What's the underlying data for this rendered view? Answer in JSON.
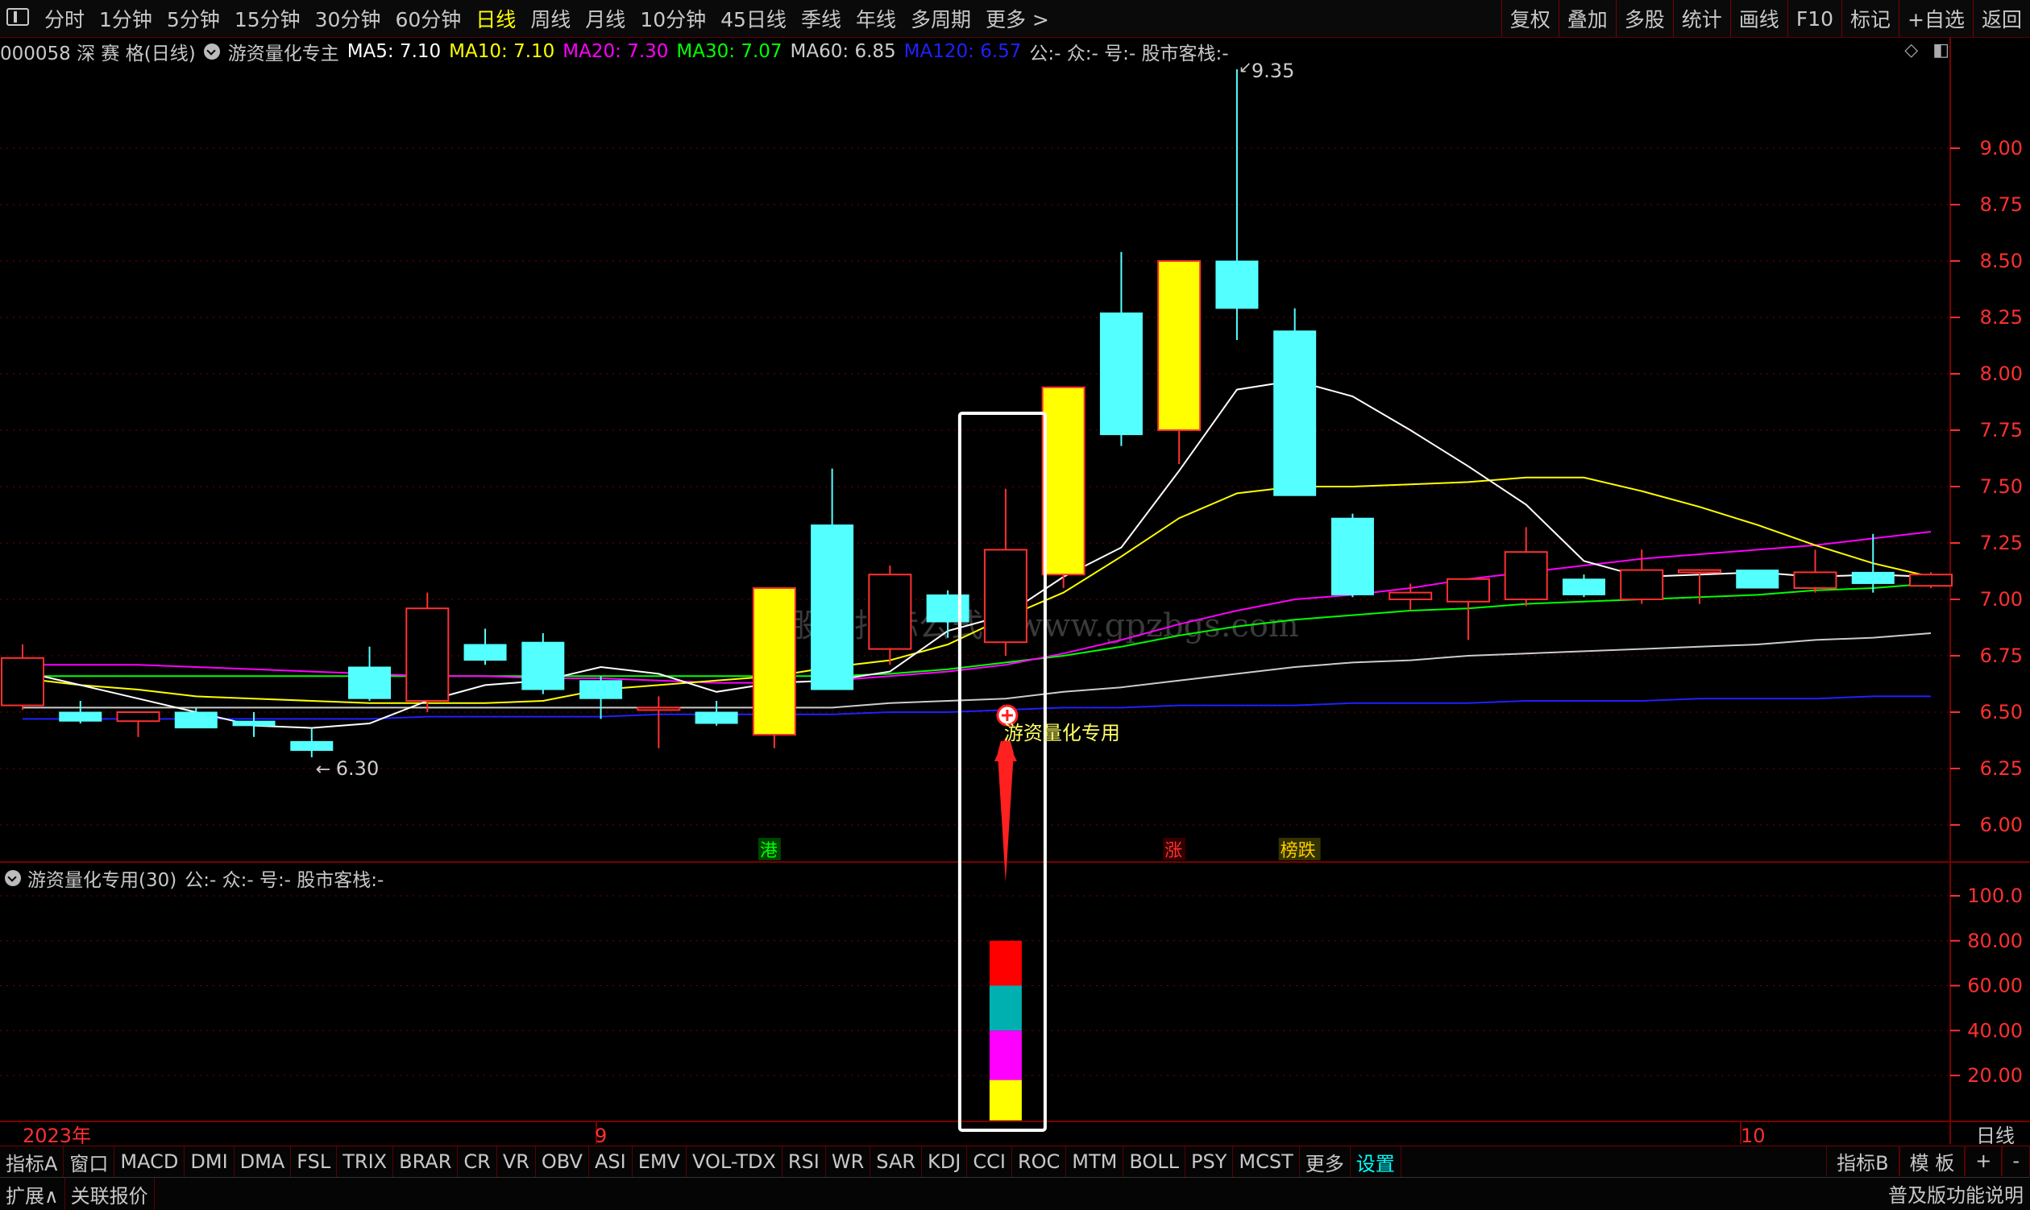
{
  "topbar": {
    "periods": [
      "分时",
      "1分钟",
      "5分钟",
      "15分钟",
      "30分钟",
      "60分钟",
      "日线",
      "周线",
      "月线",
      "10分钟",
      "45日线",
      "季线",
      "年线",
      "多周期",
      "更多 >"
    ],
    "active_period": "日线",
    "right_items": [
      "复权",
      "叠加",
      "多股",
      "统计",
      "画线",
      "F10",
      "标记",
      "+自选",
      "返回"
    ]
  },
  "infobar": {
    "stock": "000058 深 赛 格(日线)",
    "indicator": "游资量化专主",
    "ma5": "MA5: 7.10",
    "ma10": "MA10: 7.10",
    "ma20": "MA20: 7.30",
    "ma30": "MA30: 7.07",
    "ma60": "MA60: 6.85",
    "ma120": "MA120: 6.57",
    "tail": "公:- 众:- 号:- 股市客栈:-"
  },
  "colors": {
    "ma5": "#ffffff",
    "ma10": "#ffff00",
    "ma20": "#ff00ff",
    "ma30": "#00ff00",
    "ma60": "#cccccc",
    "ma120": "#2020ff",
    "up": "#ff3030",
    "down": "#54ffff",
    "signal": "#ffff00",
    "grid": "#7a0000"
  },
  "price_axis": [
    "9.00",
    "8.75",
    "8.50",
    "8.25",
    "8.00",
    "7.75",
    "7.50",
    "7.25",
    "7.00",
    "6.75",
    "6.50",
    "6.25",
    "6.00"
  ],
  "sub_axis": [
    "100.0",
    "80.00",
    "60.00",
    "40.00",
    "20.00"
  ],
  "annotations": {
    "high": "9.35",
    "low": "6.30",
    "watermark": "股票指标公式网www.gpzbgs.com",
    "signal_label": "游资量化专用",
    "tags": [
      "港",
      "涨",
      "榜跌"
    ]
  },
  "subinfo": {
    "title": "游资量化专用(30)",
    "tail": "公:- 众:- 号:- 股市客栈:-"
  },
  "date_axis": {
    "year": "2023年",
    "m9": "9",
    "m10": "10",
    "period": "日线"
  },
  "bottombar1": {
    "items": [
      "指标A",
      "窗口",
      "MACD",
      "DMI",
      "DMA",
      "FSL",
      "TRIX",
      "BRAR",
      "CR",
      "VR",
      "OBV",
      "ASI",
      "EMV",
      "VOL-TDX",
      "RSI",
      "WR",
      "SAR",
      "KDJ",
      "CCI",
      "ROC",
      "MTM",
      "BOLL",
      "PSY",
      "MCST",
      "更多",
      "设置"
    ],
    "right": [
      "指标B",
      "模 板",
      "+",
      "-"
    ]
  },
  "bottombar2": {
    "items": [
      "扩展∧",
      "关联报价"
    ],
    "right": "普及版功能说明"
  },
  "chart_data": {
    "type": "candlestick",
    "ylim": [
      5.9,
      9.45
    ],
    "candles": [
      {
        "o": 6.53,
        "h": 6.8,
        "l": 6.51,
        "c": 6.74
      },
      {
        "o": 6.5,
        "h": 6.55,
        "l": 6.45,
        "c": 6.46
      },
      {
        "o": 6.46,
        "h": 6.5,
        "l": 6.39,
        "c": 6.5
      },
      {
        "o": 6.5,
        "h": 6.52,
        "l": 6.43,
        "c": 6.43
      },
      {
        "o": 6.46,
        "h": 6.5,
        "l": 6.39,
        "c": 6.44
      },
      {
        "o": 6.37,
        "h": 6.43,
        "l": 6.3,
        "c": 6.33
      },
      {
        "o": 6.7,
        "h": 6.79,
        "l": 6.55,
        "c": 6.56
      },
      {
        "o": 6.55,
        "h": 7.03,
        "l": 6.5,
        "c": 6.96
      },
      {
        "o": 6.8,
        "h": 6.87,
        "l": 6.71,
        "c": 6.73
      },
      {
        "o": 6.81,
        "h": 6.85,
        "l": 6.58,
        "c": 6.6
      },
      {
        "o": 6.64,
        "h": 6.66,
        "l": 6.47,
        "c": 6.56
      },
      {
        "o": 6.52,
        "h": 6.57,
        "l": 6.34,
        "c": 6.52
      },
      {
        "o": 6.5,
        "h": 6.55,
        "l": 6.44,
        "c": 6.45
      },
      {
        "o": 6.4,
        "h": 7.05,
        "l": 6.34,
        "c": 7.05
      },
      {
        "o": 7.33,
        "h": 7.58,
        "l": 6.6,
        "c": 6.6
      },
      {
        "o": 6.78,
        "h": 7.15,
        "l": 6.71,
        "c": 7.11
      },
      {
        "o": 7.02,
        "h": 7.04,
        "l": 6.83,
        "c": 6.9
      },
      {
        "o": 6.81,
        "h": 7.49,
        "l": 6.75,
        "c": 7.22
      },
      {
        "o": 7.11,
        "h": 7.94,
        "l": 7.05,
        "c": 7.94
      },
      {
        "o": 8.27,
        "h": 8.54,
        "l": 7.68,
        "c": 7.73
      },
      {
        "o": 7.75,
        "h": 8.5,
        "l": 7.6,
        "c": 8.5
      },
      {
        "o": 8.5,
        "h": 9.35,
        "l": 8.15,
        "c": 8.29
      },
      {
        "o": 8.19,
        "h": 8.29,
        "l": 7.47,
        "c": 7.46
      },
      {
        "o": 7.36,
        "h": 7.38,
        "l": 7.01,
        "c": 7.02
      },
      {
        "o": 7.0,
        "h": 7.07,
        "l": 6.95,
        "c": 7.03
      },
      {
        "o": 6.99,
        "h": 7.09,
        "l": 6.82,
        "c": 7.09
      },
      {
        "o": 7.0,
        "h": 7.32,
        "l": 6.97,
        "c": 7.21
      },
      {
        "o": 7.09,
        "h": 7.11,
        "l": 7.01,
        "c": 7.02
      },
      {
        "o": 7.0,
        "h": 7.22,
        "l": 6.98,
        "c": 7.13
      },
      {
        "o": 7.13,
        "h": 7.12,
        "l": 6.98,
        "c": 7.13
      },
      {
        "o": 7.13,
        "h": 7.13,
        "l": 7.05,
        "c": 7.05
      },
      {
        "o": 7.05,
        "h": 7.22,
        "l": 7.03,
        "c": 7.12
      },
      {
        "o": 7.12,
        "h": 7.29,
        "l": 7.03,
        "c": 7.07
      },
      {
        "o": 7.06,
        "h": 7.12,
        "l": 7.05,
        "c": 7.11
      }
    ],
    "ma": {
      "ma5": [
        6.68,
        6.62,
        6.56,
        6.5,
        6.44,
        6.43,
        6.45,
        6.55,
        6.62,
        6.64,
        6.7,
        6.67,
        6.59,
        6.63,
        6.64,
        6.68,
        6.86,
        6.93,
        7.1,
        7.23,
        7.57,
        7.93,
        7.97,
        7.9,
        7.75,
        7.59,
        7.42,
        7.17,
        7.1,
        7.11,
        7.12,
        7.1,
        7.11,
        7.1
      ],
      "ma10": [
        6.65,
        6.62,
        6.6,
        6.57,
        6.56,
        6.55,
        6.54,
        6.54,
        6.54,
        6.55,
        6.6,
        6.62,
        6.64,
        6.66,
        6.7,
        6.73,
        6.8,
        6.92,
        7.03,
        7.19,
        7.36,
        7.47,
        7.5,
        7.5,
        7.51,
        7.52,
        7.54,
        7.54,
        7.48,
        7.41,
        7.33,
        7.24,
        7.16,
        7.1
      ],
      "ma20": [
        6.71,
        6.71,
        6.71,
        6.7,
        6.69,
        6.68,
        6.67,
        6.66,
        6.66,
        6.65,
        6.65,
        6.64,
        6.63,
        6.63,
        6.64,
        6.66,
        6.68,
        6.71,
        6.76,
        6.82,
        6.89,
        6.95,
        7.0,
        7.02,
        7.05,
        7.09,
        7.12,
        7.15,
        7.18,
        7.2,
        7.22,
        7.24,
        7.27,
        7.3
      ],
      "ma30": [
        6.66,
        6.66,
        6.66,
        6.66,
        6.66,
        6.66,
        6.66,
        6.66,
        6.66,
        6.66,
        6.66,
        6.66,
        6.66,
        6.66,
        6.66,
        6.67,
        6.69,
        6.72,
        6.75,
        6.79,
        6.84,
        6.88,
        6.91,
        6.93,
        6.95,
        6.96,
        6.98,
        6.99,
        7.0,
        7.01,
        7.02,
        7.04,
        7.05,
        7.07
      ],
      "ma60": [
        6.52,
        6.52,
        6.52,
        6.52,
        6.52,
        6.52,
        6.52,
        6.52,
        6.52,
        6.52,
        6.52,
        6.52,
        6.52,
        6.52,
        6.52,
        6.54,
        6.55,
        6.56,
        6.59,
        6.61,
        6.64,
        6.67,
        6.7,
        6.72,
        6.73,
        6.75,
        6.76,
        6.77,
        6.78,
        6.79,
        6.8,
        6.82,
        6.83,
        6.85
      ],
      "ma120": [
        6.47,
        6.47,
        6.47,
        6.47,
        6.47,
        6.47,
        6.47,
        6.48,
        6.48,
        6.48,
        6.48,
        6.49,
        6.49,
        6.49,
        6.49,
        6.5,
        6.5,
        6.51,
        6.52,
        6.52,
        6.53,
        6.53,
        6.53,
        6.54,
        6.54,
        6.54,
        6.55,
        6.55,
        6.55,
        6.56,
        6.56,
        6.56,
        6.57,
        6.57
      ]
    },
    "signal_index": 17,
    "signal_segments": [
      {
        "from": 0,
        "to": 18,
        "color": "#ffff00"
      },
      {
        "from": 18,
        "to": 40,
        "color": "#ff00ff"
      },
      {
        "from": 40,
        "to": 60,
        "color": "#00b0b0"
      },
      {
        "from": 60,
        "to": 80,
        "color": "#ff0000"
      }
    ],
    "sub_ylim": [
      0,
      110
    ]
  }
}
